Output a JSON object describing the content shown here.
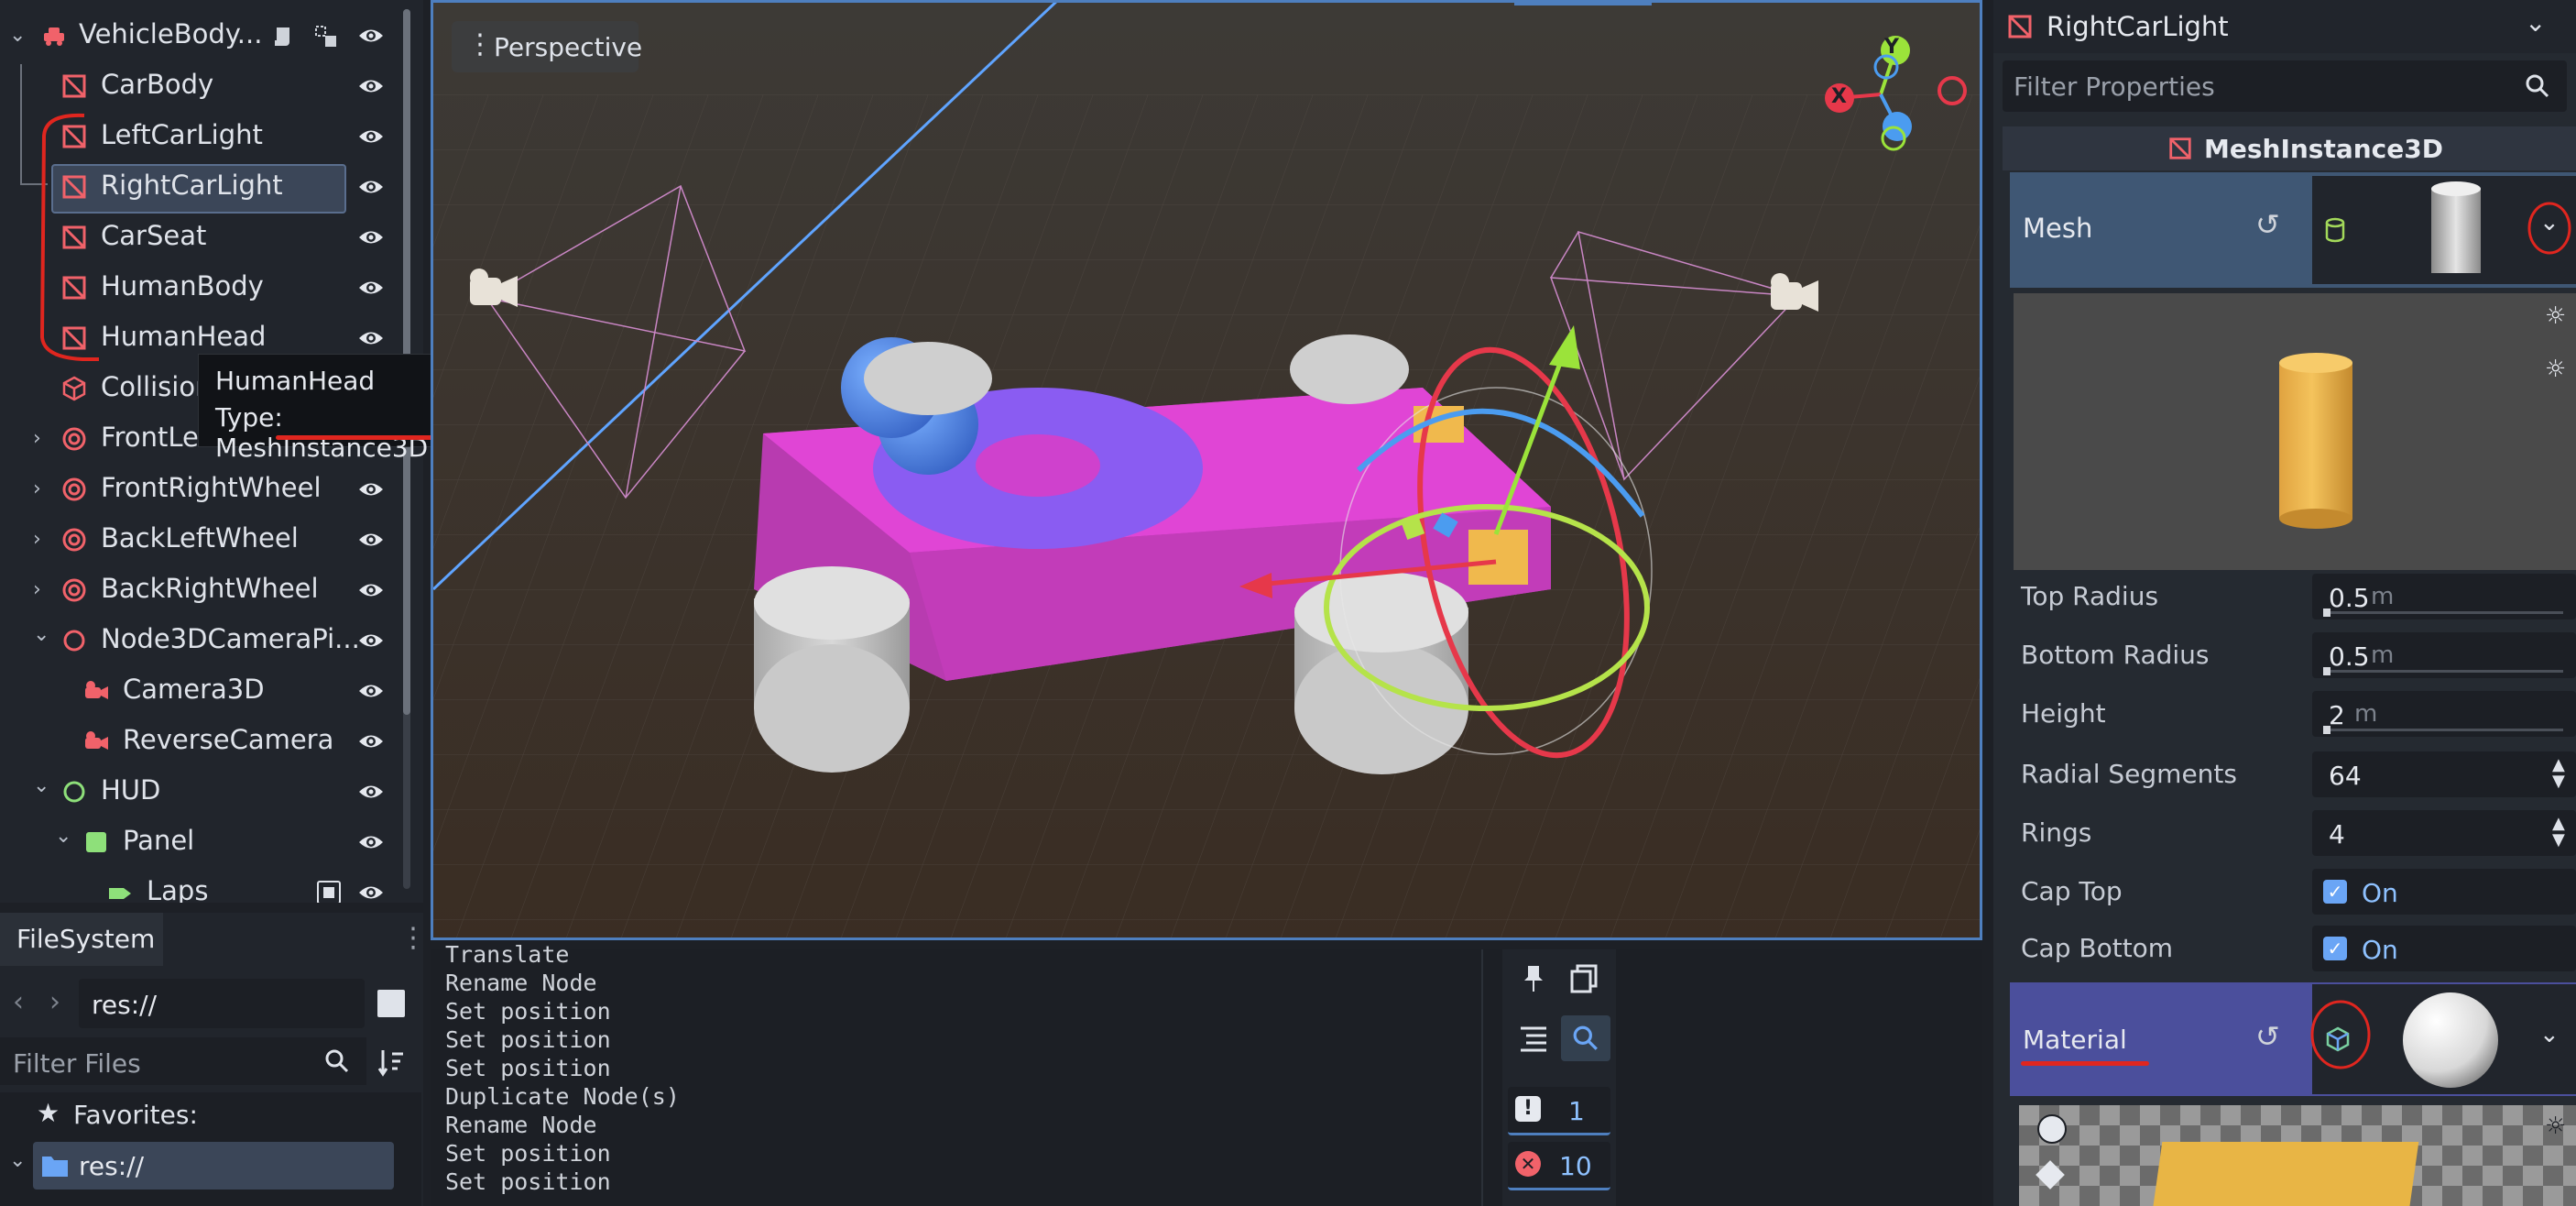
{
  "scene_tree": {
    "root": {
      "label": "VehicleBody...",
      "icon": "vehicle-body-icon"
    },
    "items": [
      {
        "label": "CarBody",
        "icon": "mesh-instance-icon",
        "indent": 1
      },
      {
        "label": "LeftCarLight",
        "icon": "mesh-instance-icon",
        "indent": 1
      },
      {
        "label": "RightCarLight",
        "icon": "mesh-instance-icon",
        "indent": 1,
        "selected": true
      },
      {
        "label": "CarSeat",
        "icon": "mesh-instance-icon",
        "indent": 1
      },
      {
        "label": "HumanBody",
        "icon": "mesh-instance-icon",
        "indent": 1
      },
      {
        "label": "HumanHead",
        "icon": "mesh-instance-icon",
        "indent": 1
      },
      {
        "label": "Collision",
        "icon": "collision-shape-icon",
        "indent": 1
      },
      {
        "label": "FrontLeftWheel",
        "icon": "wheel-icon",
        "indent": 1,
        "collapsed": true
      },
      {
        "label": "FrontRightWheel",
        "icon": "wheel-icon",
        "indent": 1,
        "collapsed": true
      },
      {
        "label": "BackLeftWheel",
        "icon": "wheel-icon",
        "indent": 1,
        "collapsed": true
      },
      {
        "label": "BackRightWheel",
        "icon": "wheel-icon",
        "indent": 1,
        "collapsed": true
      },
      {
        "label": "Node3DCameraPi...",
        "icon": "node3d-icon",
        "indent": 1,
        "expanded": true
      },
      {
        "label": "Camera3D",
        "icon": "camera3d-icon",
        "indent": 2
      },
      {
        "label": "ReverseCamera",
        "icon": "camera3d-icon",
        "indent": 2
      },
      {
        "label": "HUD",
        "icon": "control-icon",
        "indent": 1,
        "expanded": true
      },
      {
        "label": "Panel",
        "icon": "panel-icon",
        "indent": 2,
        "expanded": true
      },
      {
        "label": "Laps",
        "icon": "label-icon",
        "indent": 3
      }
    ],
    "tooltip": {
      "name": "HumanHead",
      "type_line": "Type: MeshInstance3D"
    }
  },
  "viewport": {
    "mode_label": "Perspective",
    "gizmo": {
      "x": "X",
      "y": "Y"
    }
  },
  "filesystem": {
    "tab_label": "FileSystem",
    "path": "res://",
    "filter_placeholder": "Filter Files",
    "favorites_label": "Favorites:",
    "root_label": "res://"
  },
  "output": {
    "lines": [
      "Translate",
      "Rename Node",
      "Set position",
      "Set position",
      "Set position",
      "Duplicate Node(s)",
      "Rename Node",
      "Set position",
      "Set position"
    ],
    "warning_count": "1",
    "error_count": "10"
  },
  "inspector": {
    "node_name": "RightCarLight",
    "filter_placeholder": "Filter Properties",
    "class_name": "MeshInstance3D",
    "mesh_label": "Mesh",
    "properties": [
      {
        "label": "Top Radius",
        "value": "0.5",
        "unit": "m"
      },
      {
        "label": "Bottom Radius",
        "value": "0.5",
        "unit": "m"
      },
      {
        "label": "Height",
        "value": "2",
        "unit": "m"
      },
      {
        "label": "Radial Segments",
        "value": "64"
      },
      {
        "label": "Rings",
        "value": "4"
      },
      {
        "label": "Cap Top",
        "value": "On"
      },
      {
        "label": "Cap Bottom",
        "value": "On"
      }
    ],
    "material_label": "Material"
  },
  "colors": {
    "accent_blue": "#4e7fbf",
    "annotation_red": "#e0261f",
    "mesh_icon_red": "#f1626a",
    "car_body_magenta": "#d93fd0",
    "torus_purple": "#8a5cf2",
    "sphere_blue": "#5b8ef0",
    "wheel_gray": "#c8c8c8",
    "light_yellow": "#f0b94d",
    "inspector_section_blue": "#3f5774",
    "material_section_purple": "#4b4f9c",
    "gizmo_red": "#e6384a",
    "gizmo_green": "#9be33a",
    "gizmo_blue": "#4b9cf0"
  }
}
